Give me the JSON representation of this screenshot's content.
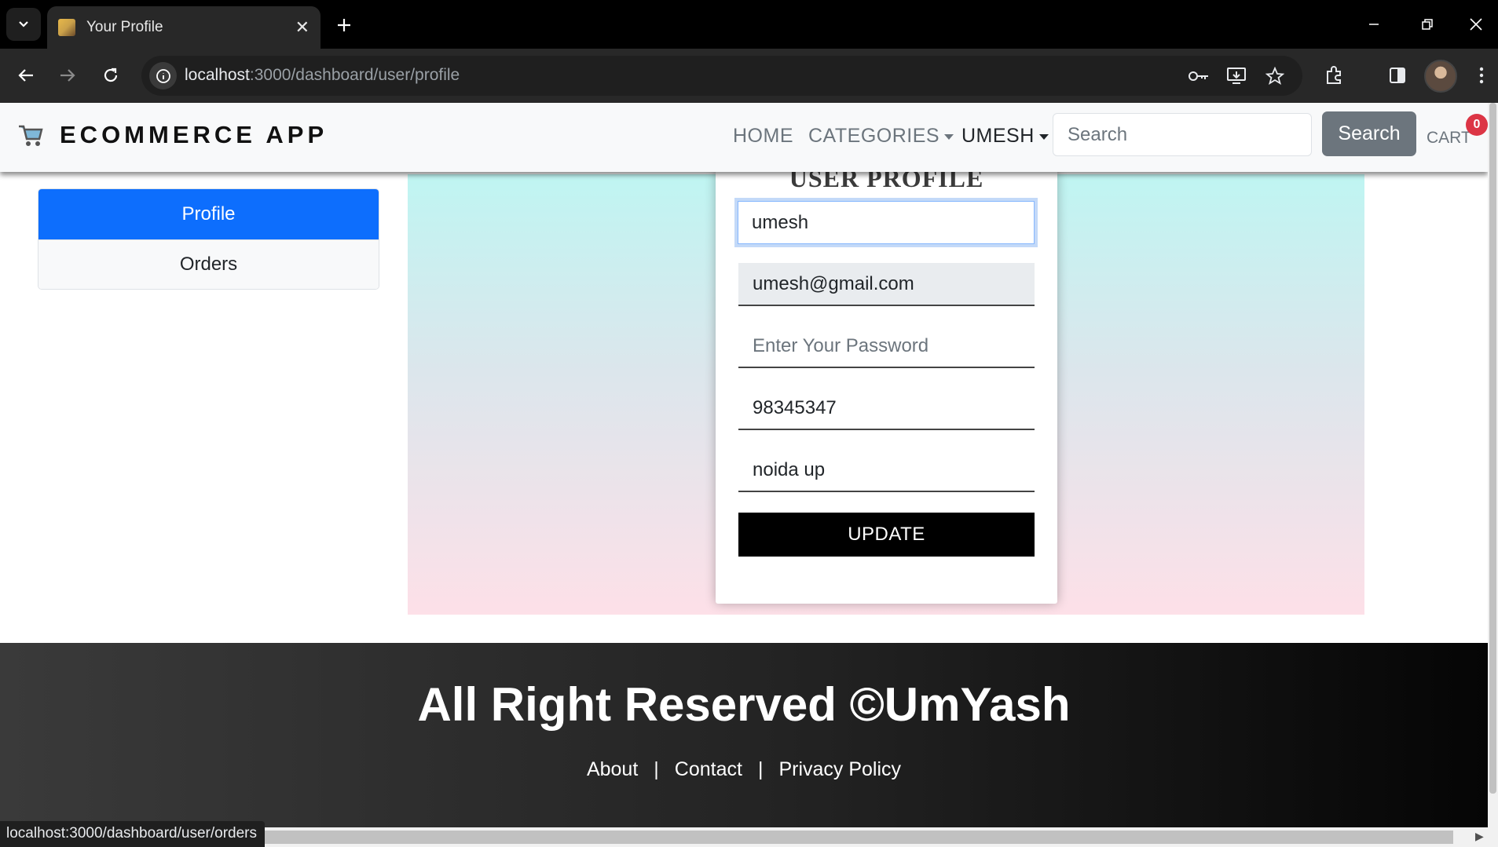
{
  "browser": {
    "tab_title": "Your Profile",
    "url_host": "localhost",
    "url_rest": ":3000/dashboard/user/profile",
    "status_url": "localhost:3000/dashboard/user/orders"
  },
  "navbar": {
    "brand": "ECOMMERCE APP",
    "links": [
      "HOME",
      "CATEGORIES",
      "UMESH"
    ],
    "search_placeholder": "Search",
    "search_button": "Search",
    "cart_label": "CART",
    "cart_count": "0",
    "cart_badge_color": "#dc3545"
  },
  "sidebar": {
    "items": [
      "Profile",
      "Orders"
    ],
    "active_color": "#0d6efd"
  },
  "form": {
    "title": "USER PROFILE",
    "name_value": "umesh",
    "email_value": "umesh@gmail.com",
    "password_placeholder": "Enter Your Password",
    "phone_value": "98345347",
    "address_value": "noida up",
    "submit_label": "UPDATE"
  },
  "footer": {
    "title": "All Right Reserved ©UmYash",
    "links": [
      "About",
      "Contact",
      "Privacy Policy"
    ],
    "separator": "|"
  }
}
